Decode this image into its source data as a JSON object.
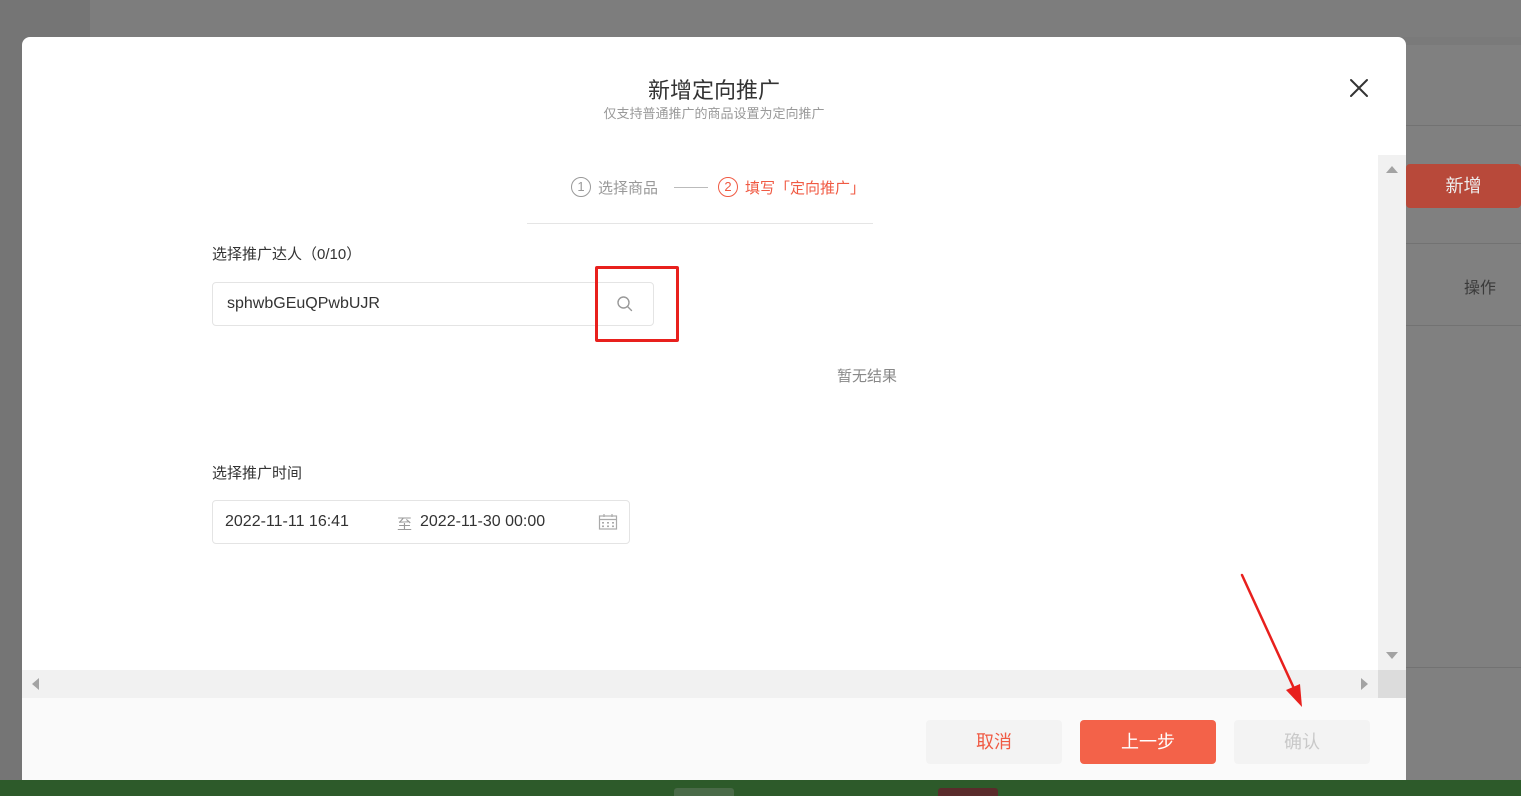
{
  "background": {
    "add_button_label": "新增",
    "column_header_label": "操作"
  },
  "modal": {
    "title": "新增定向推广",
    "subtitle": "仅支持普通推广的商品设置为定向推广",
    "steps": [
      {
        "number": "1",
        "label": "选择商品",
        "state": "done"
      },
      {
        "number": "2",
        "label": "填写「定向推广」",
        "state": "active"
      }
    ],
    "influencer_section": {
      "label": "选择推广达人（0/10）",
      "search_value": "sphwbGEuQPwbUJR",
      "empty_text": "暂无结果"
    },
    "time_section": {
      "label": "选择推广时间",
      "start": "2022-11-11 16:41",
      "separator": "至",
      "end": "2022-11-30 00:00"
    },
    "footer": {
      "cancel_label": "取消",
      "prev_label": "上一步",
      "confirm_label": "确认"
    }
  },
  "colors": {
    "accent": "#f05a43",
    "primary_button": "#f36249",
    "annotation_red": "#e8201d"
  },
  "icons": [
    "close-icon",
    "search-icon",
    "calendar-icon"
  ]
}
